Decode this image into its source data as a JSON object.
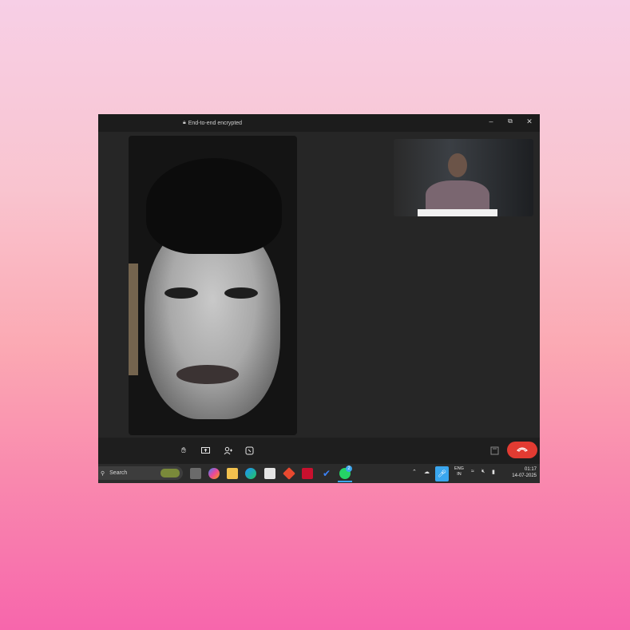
{
  "titlebar": {
    "encryption_label": "End-to-end encrypted",
    "lock_icon": "lock-icon",
    "controls": [
      "minimize-icon",
      "restore-icon",
      "close-icon"
    ]
  },
  "call": {
    "main_participant": "video-main",
    "self_view": "video-pip",
    "toolbar_icons": [
      "raise-hand-icon",
      "screen-share-icon",
      "add-person-icon",
      "effects-icon"
    ],
    "end_call_icon": "end-call-icon",
    "end_call_color": "#e23b32"
  },
  "taskbar": {
    "search_placeholder": "Search",
    "apps": [
      "task-view-icon",
      "copilot-icon",
      "file-explorer-icon",
      "edge-icon",
      "store-icon",
      "git-icon",
      "mcafee-icon",
      "todo-icon",
      "whatsapp-icon"
    ],
    "whatsapp_badge": "2",
    "language": "ENG",
    "region": "IN",
    "time": "01:17",
    "date": "14-07-2025",
    "accent": "#3aa6ee"
  }
}
